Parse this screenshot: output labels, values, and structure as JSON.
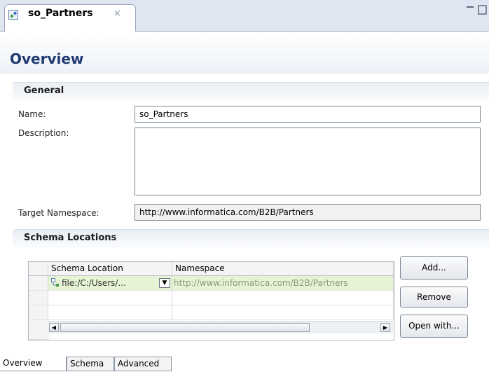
{
  "editor_tab": {
    "title": "so_Partners",
    "close": "×"
  },
  "page_title": "Overview",
  "general": {
    "section_title": "General",
    "name_label": "Name:",
    "name_value": "so_Partners",
    "description_label": "Description:",
    "description_value": "",
    "namespace_label": "Target Namespace:",
    "namespace_value": "http://www.informatica.com/B2B/Partners"
  },
  "schema_locations": {
    "section_title": "Schema Locations",
    "columns": [
      "Schema Location",
      "Namespace"
    ],
    "rows": [
      {
        "location": "file:/C:/Users/...",
        "namespace": "http://www.informatica.com/B2B/Partners"
      }
    ],
    "buttons": {
      "add": "Add...",
      "remove": "Remove",
      "open_with": "Open with..."
    }
  },
  "bottom_tabs": [
    "Overview",
    "Schema",
    "Advanced"
  ],
  "colors": {
    "title": "#1f3a70",
    "row_highlight": "#e6f3d4",
    "namespace_text": "#8a9a80"
  }
}
